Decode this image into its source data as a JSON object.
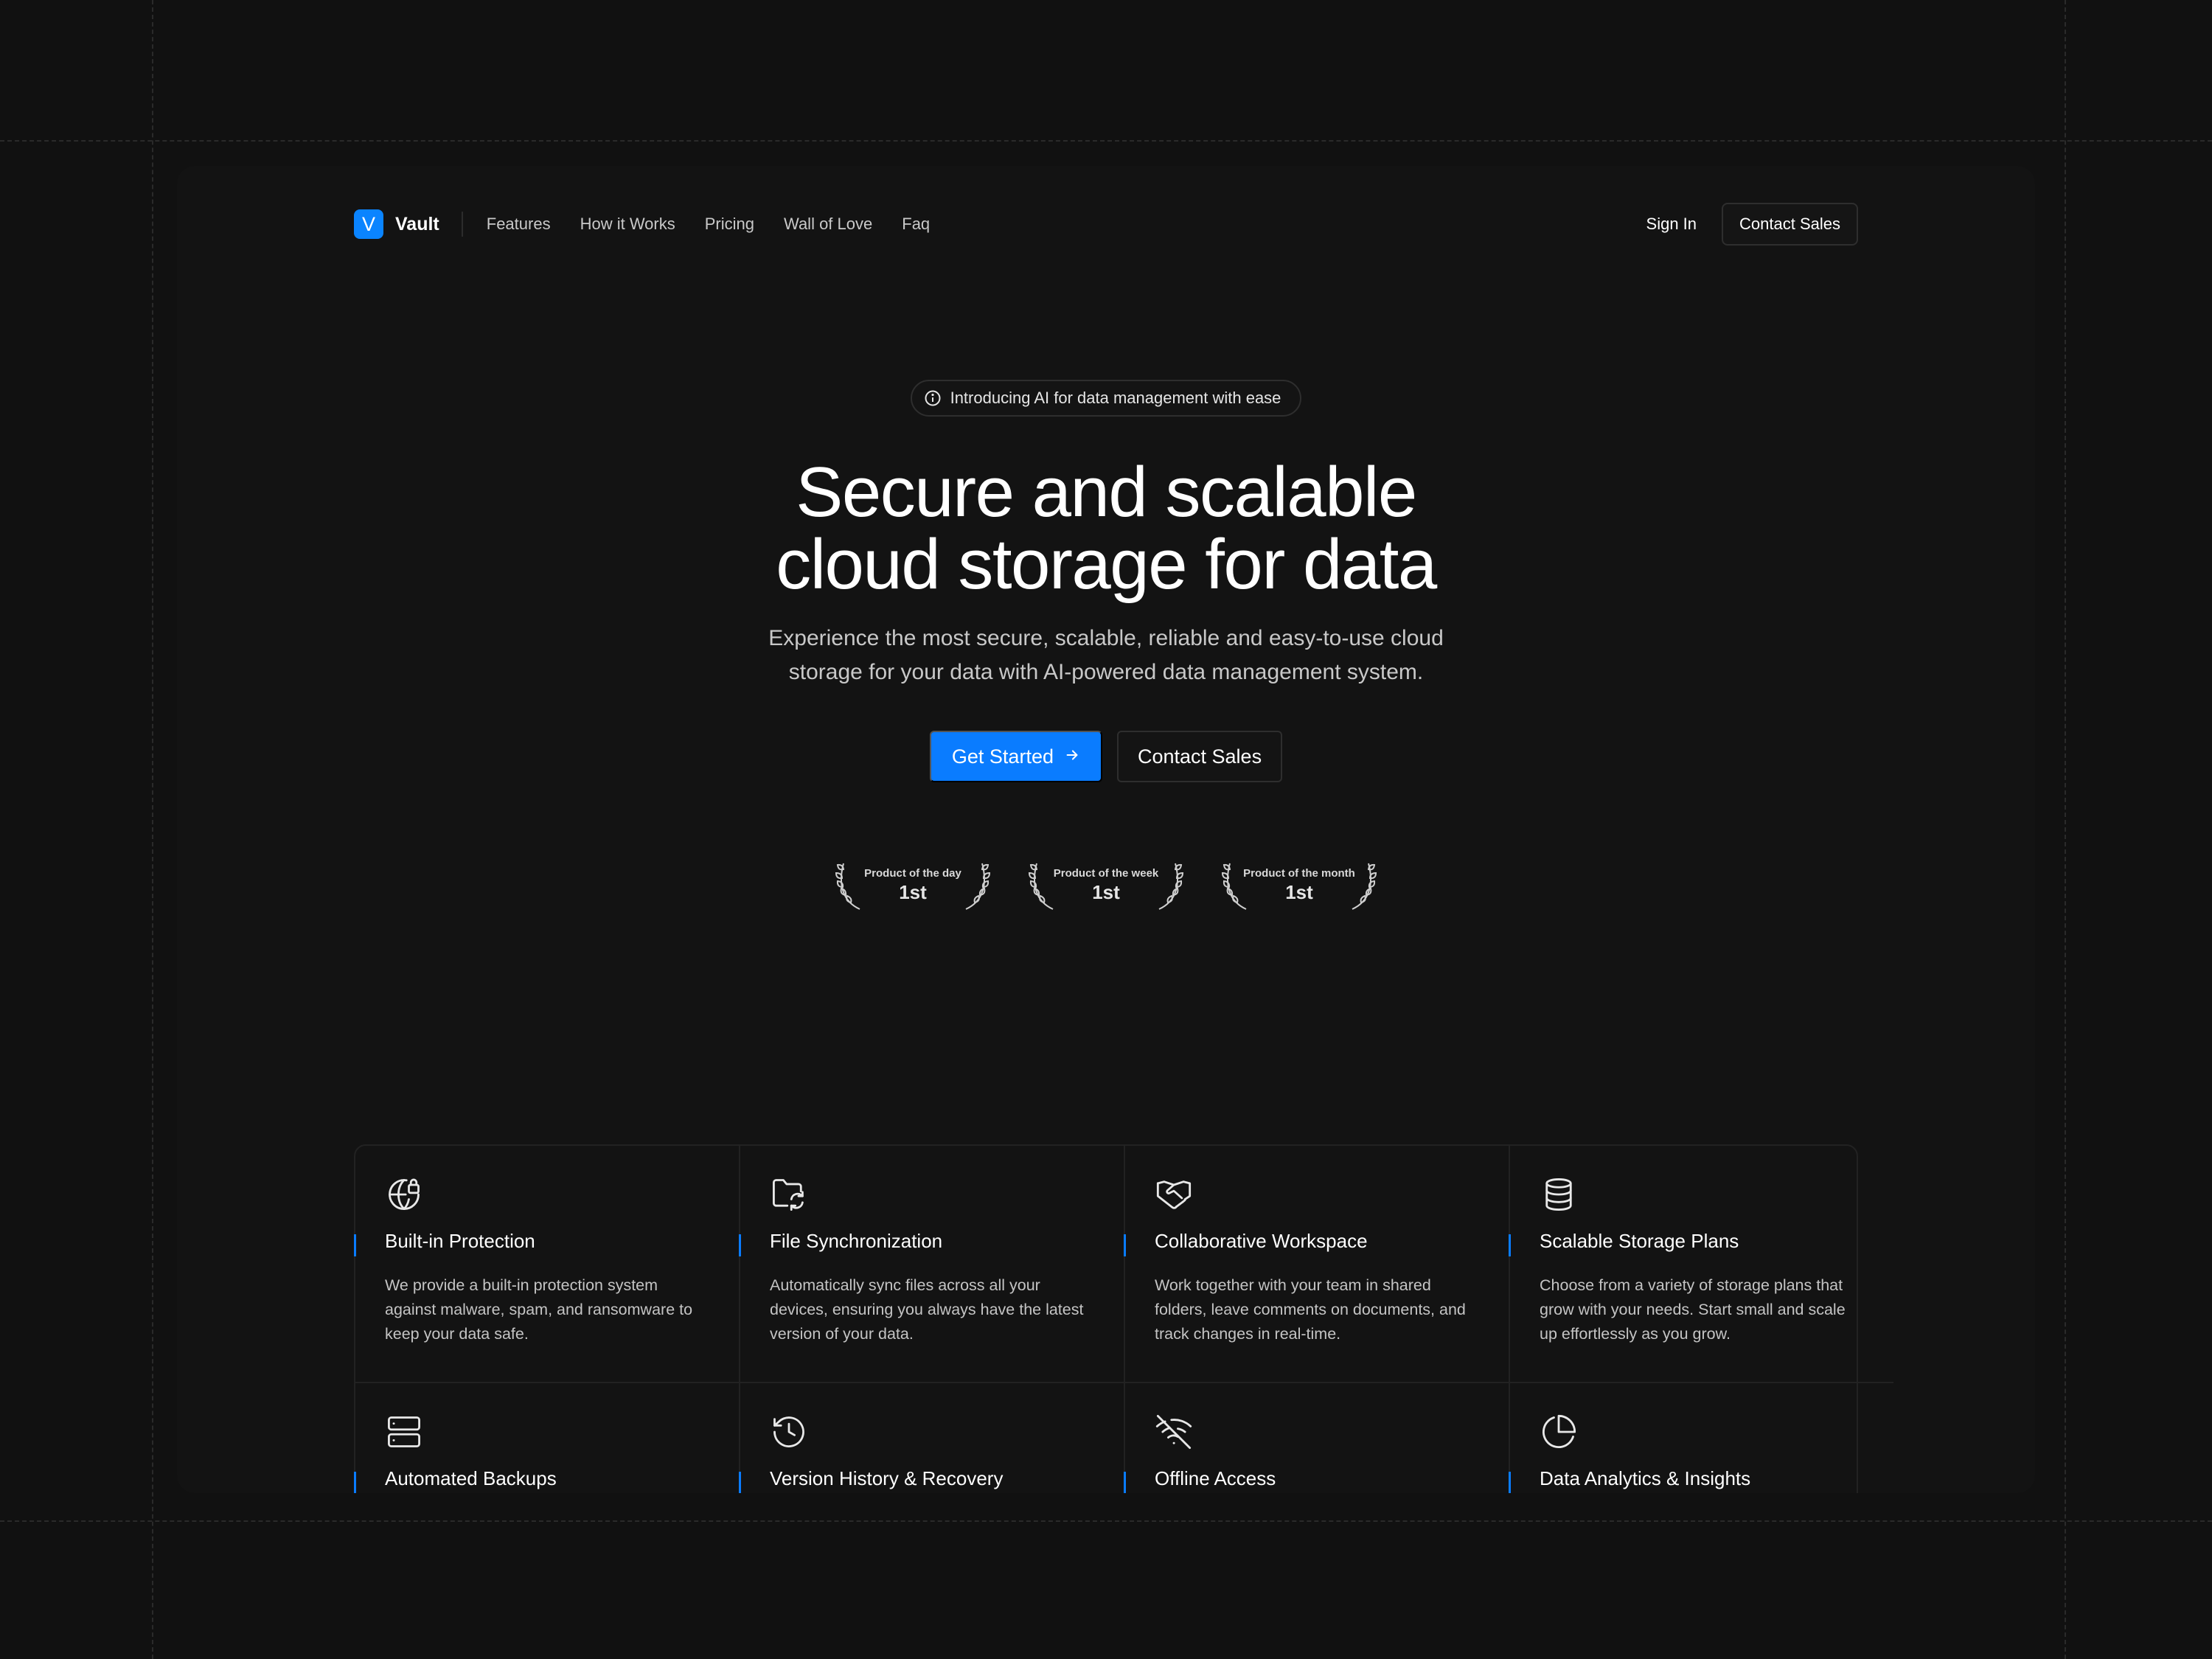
{
  "nav": {
    "logo_letter": "V",
    "brand": "Vault",
    "links": [
      "Features",
      "How it Works",
      "Pricing",
      "Wall of Love",
      "Faq"
    ],
    "sign_in": "Sign In",
    "contact": "Contact Sales"
  },
  "hero": {
    "badge_icon": "info-icon",
    "badge_text": "Introducing AI for data management with ease",
    "headline_line1": "Secure and scalable",
    "headline_line2": "cloud storage for data",
    "subtitle": "Experience the most secure, scalable, reliable and easy-to-use cloud storage for your data with AI-powered data management system.",
    "primary_cta": "Get Started",
    "secondary_cta": "Contact Sales"
  },
  "awards": [
    {
      "label": "Product of the day",
      "rank": "1st"
    },
    {
      "label": "Product of the week",
      "rank": "1st"
    },
    {
      "label": "Product of the month",
      "rank": "1st"
    }
  ],
  "features": [
    {
      "icon": "globe-lock-icon",
      "title": "Built-in Protection",
      "desc": "We provide a built-in protection system against malware, spam, and ransomware to keep your data safe."
    },
    {
      "icon": "folder-sync-icon",
      "title": "File Synchronization",
      "desc": "Automatically sync files across all your devices, ensuring you always have the latest version of your data."
    },
    {
      "icon": "handshake-icon",
      "title": "Collaborative Workspace",
      "desc": "Work together with your team in shared folders, leave comments on documents, and track changes in real-time."
    },
    {
      "icon": "database-icon",
      "title": "Scalable Storage Plans",
      "desc": "Choose from a variety of storage plans that grow with your needs. Start small and scale up effortlessly as you grow."
    },
    {
      "icon": "server-icon",
      "title": "Automated Backups",
      "desc": ""
    },
    {
      "icon": "history-icon",
      "title": "Version History & Recovery",
      "desc": ""
    },
    {
      "icon": "wifi-off-icon",
      "title": "Offline Access",
      "desc": ""
    },
    {
      "icon": "pie-chart-icon",
      "title": "Data Analytics & Insights",
      "desc": ""
    }
  ],
  "colors": {
    "background": "#111111",
    "frame": "#131313",
    "accent": "#0a7cff"
  }
}
